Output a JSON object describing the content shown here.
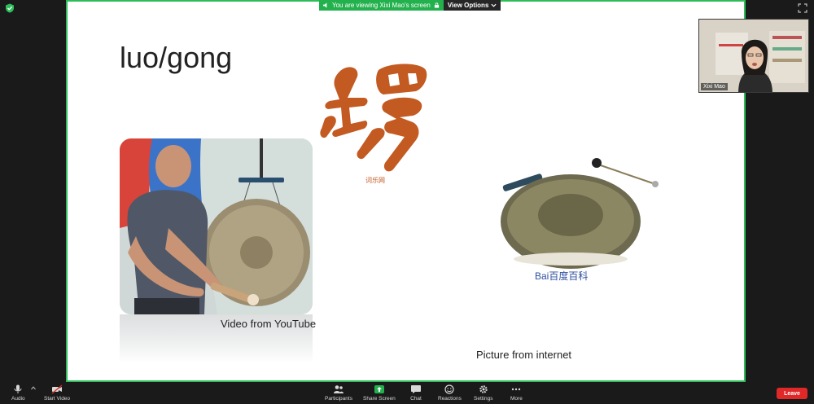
{
  "banner": {
    "viewing_text": "You are viewing Xixi Mao's screen",
    "view_options_label": "View Options"
  },
  "slide": {
    "title": "luo/gong",
    "calligraphy_caption": "词乐网",
    "video_caption": "Video from YouTube",
    "picture_caption": "Picture from internet",
    "watermark": "Bai百度百科"
  },
  "participant": {
    "name": "Xixi Mao"
  },
  "toolbar": {
    "audio": "Audio",
    "start_video": "Start Video",
    "participants": "Participants",
    "share_screen": "Share Screen",
    "chat": "Chat",
    "reactions": "Reactions",
    "settings": "Settings",
    "more": "More",
    "leave": "Leave"
  },
  "colors": {
    "share_border": "#2ebd59",
    "banner_green": "#23b14d",
    "leave_red": "#e02828",
    "calligraphy": "#c25a22"
  }
}
